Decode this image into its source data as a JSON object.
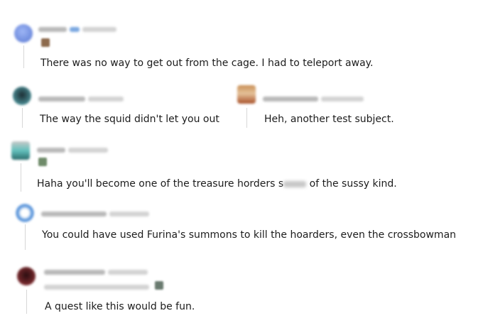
{
  "comments": [
    {
      "text": "There was no way to get out from the cage. I had to teleport away.",
      "avatar_color": "#6f8fe0"
    },
    {
      "text": "The way the squid didn't let you out",
      "avatar_color": "#2f5561"
    },
    {
      "text": "Heh, another test subject.",
      "avatar_color": "#b9773a"
    },
    {
      "text_before": "Haha you'll become one of the treasure horders s",
      "text_after": " of the sussy kind.",
      "avatar_color": "#4aa7a6"
    },
    {
      "text": "You could have used Furina's summons to kill the hoarders, even the crossbowman",
      "avatar_color": "#3d82d4"
    },
    {
      "text": "A quest like this would be fun.",
      "avatar_color": "#5a1e22"
    }
  ]
}
